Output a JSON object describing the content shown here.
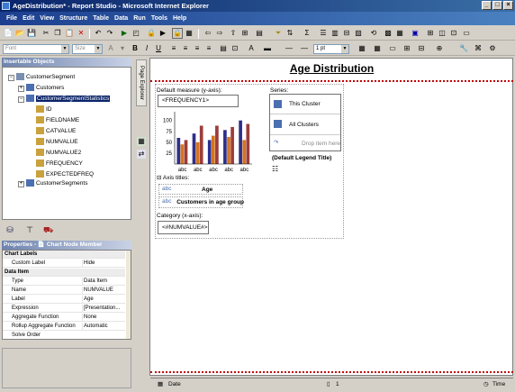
{
  "window": {
    "title": "AgeDistribution* - Report Studio - Microsoft Internet Explorer"
  },
  "menu": [
    "File",
    "Edit",
    "View",
    "Structure",
    "Table",
    "Data",
    "Run",
    "Tools",
    "Help"
  ],
  "toolbar2": {
    "font_placeholder": "Font",
    "size_placeholder": "Size",
    "line_width": "1 pt"
  },
  "insertable": {
    "header": "Insertable Objects",
    "tree": [
      {
        "label": "CustomerSegment"
      },
      {
        "label": "Customers"
      },
      {
        "label": "CustomerSegmentStatistics"
      },
      {
        "label": "ID"
      },
      {
        "label": "FIELDNAME"
      },
      {
        "label": "CATVALUE"
      },
      {
        "label": "NUMVALUE"
      },
      {
        "label": "NUMVALUE2"
      },
      {
        "label": "FREQUENCY"
      },
      {
        "label": "EXPECTEDFREQ"
      },
      {
        "label": "CustomerSegments"
      }
    ]
  },
  "properties": {
    "header": "Properties - 📄 Chart Node Member",
    "rows": [
      {
        "name": "Chart Labels",
        "value": "",
        "group": true
      },
      {
        "name": "Custom Label",
        "value": "Hide"
      },
      {
        "name": "Data Item",
        "value": "",
        "group": true
      },
      {
        "name": "Type",
        "value": "Data Item"
      },
      {
        "name": "Name",
        "value": "NUMVALUE"
      },
      {
        "name": "Label",
        "value": "Age"
      },
      {
        "name": "Expression",
        "value": "[Presentation..."
      },
      {
        "name": "Aggregate Function",
        "value": "None"
      },
      {
        "name": "Rollup Aggregate Function",
        "value": "Automatic"
      },
      {
        "name": "Solve Order",
        "value": ""
      }
    ]
  },
  "side_tab": {
    "label": "Page Explorer"
  },
  "report": {
    "title": "Age Distribution",
    "default_measure_label": "Default measure (y-axis):",
    "default_measure_value": "<FREQUENCY1>",
    "series_label": "Series:",
    "series": [
      "This Cluster",
      "All Clusters"
    ],
    "drop_here": "Drop item here",
    "legend_title": "(Default Legend Title)",
    "axis_titles_label": "Axis titles:",
    "axis_title_1": "Age",
    "axis_title_2": "Customers in age group",
    "category_label": "Category (x-axis):",
    "category_value": "<#NUMVALUE#>"
  },
  "chart_data": {
    "type": "bar",
    "categories": [
      "abc",
      "abc",
      "abc",
      "abc",
      "abc"
    ],
    "series": [
      {
        "values": [
          60,
          70,
          55,
          78,
          100
        ]
      },
      {
        "values": [
          45,
          50,
          65,
          62,
          55
        ]
      },
      {
        "values": [
          55,
          88,
          88,
          85,
          92
        ]
      }
    ],
    "yticks": [
      25,
      50,
      75,
      100
    ],
    "ylim": [
      0,
      120
    ],
    "colors": [
      "#2e2e8a",
      "#d4741c",
      "#9c3c3c"
    ]
  },
  "footer": {
    "left": "Date",
    "center": "1",
    "right": "Time"
  }
}
